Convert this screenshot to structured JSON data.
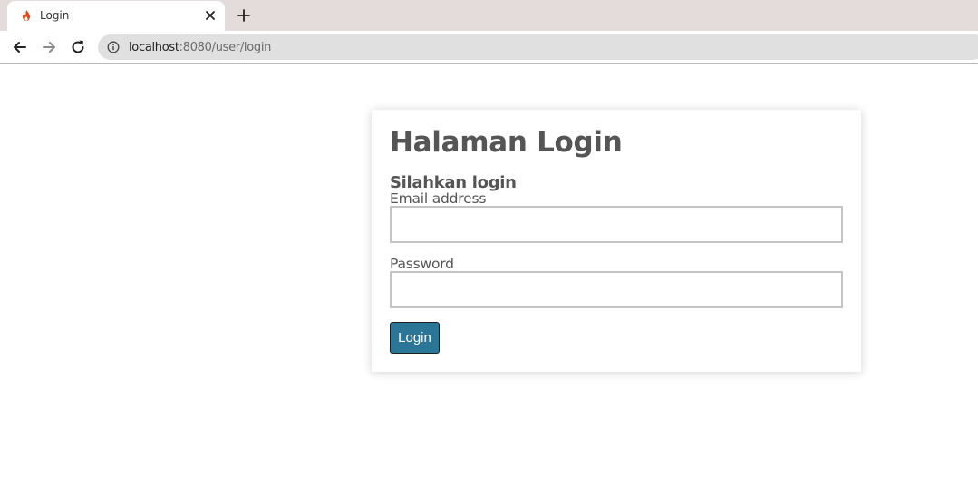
{
  "browser": {
    "tab": {
      "title": "Login",
      "favicon": "flame-icon"
    },
    "address_bar": {
      "host": "localhost",
      "rest": ":8080/user/login"
    }
  },
  "login": {
    "title": "Halaman Login",
    "subtitle": "Silahkan login",
    "email_label": "Email address",
    "email_value": "",
    "password_label": "Password",
    "password_value": "",
    "button_label": "Login"
  },
  "colors": {
    "button_bg": "#2b7596",
    "heading_text": "#555555",
    "tabstrip_bg": "#e4dcdb",
    "favicon": "#dd4814"
  }
}
